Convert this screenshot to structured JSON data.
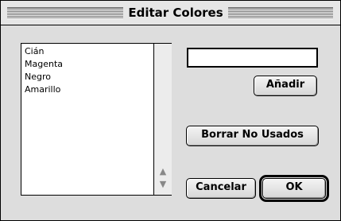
{
  "window": {
    "title": "Editar Colores"
  },
  "colors": {
    "items": [
      "Cián",
      "Magenta",
      "Negro",
      "Amarillo"
    ]
  },
  "color_name_input": {
    "value": ""
  },
  "buttons": {
    "add": "Añadir",
    "clear_unused": "Borrar No Usados",
    "cancel": "Cancelar",
    "ok": "OK"
  },
  "icons": {
    "scroll_up": "triangle-up",
    "scroll_down": "triangle-down"
  }
}
